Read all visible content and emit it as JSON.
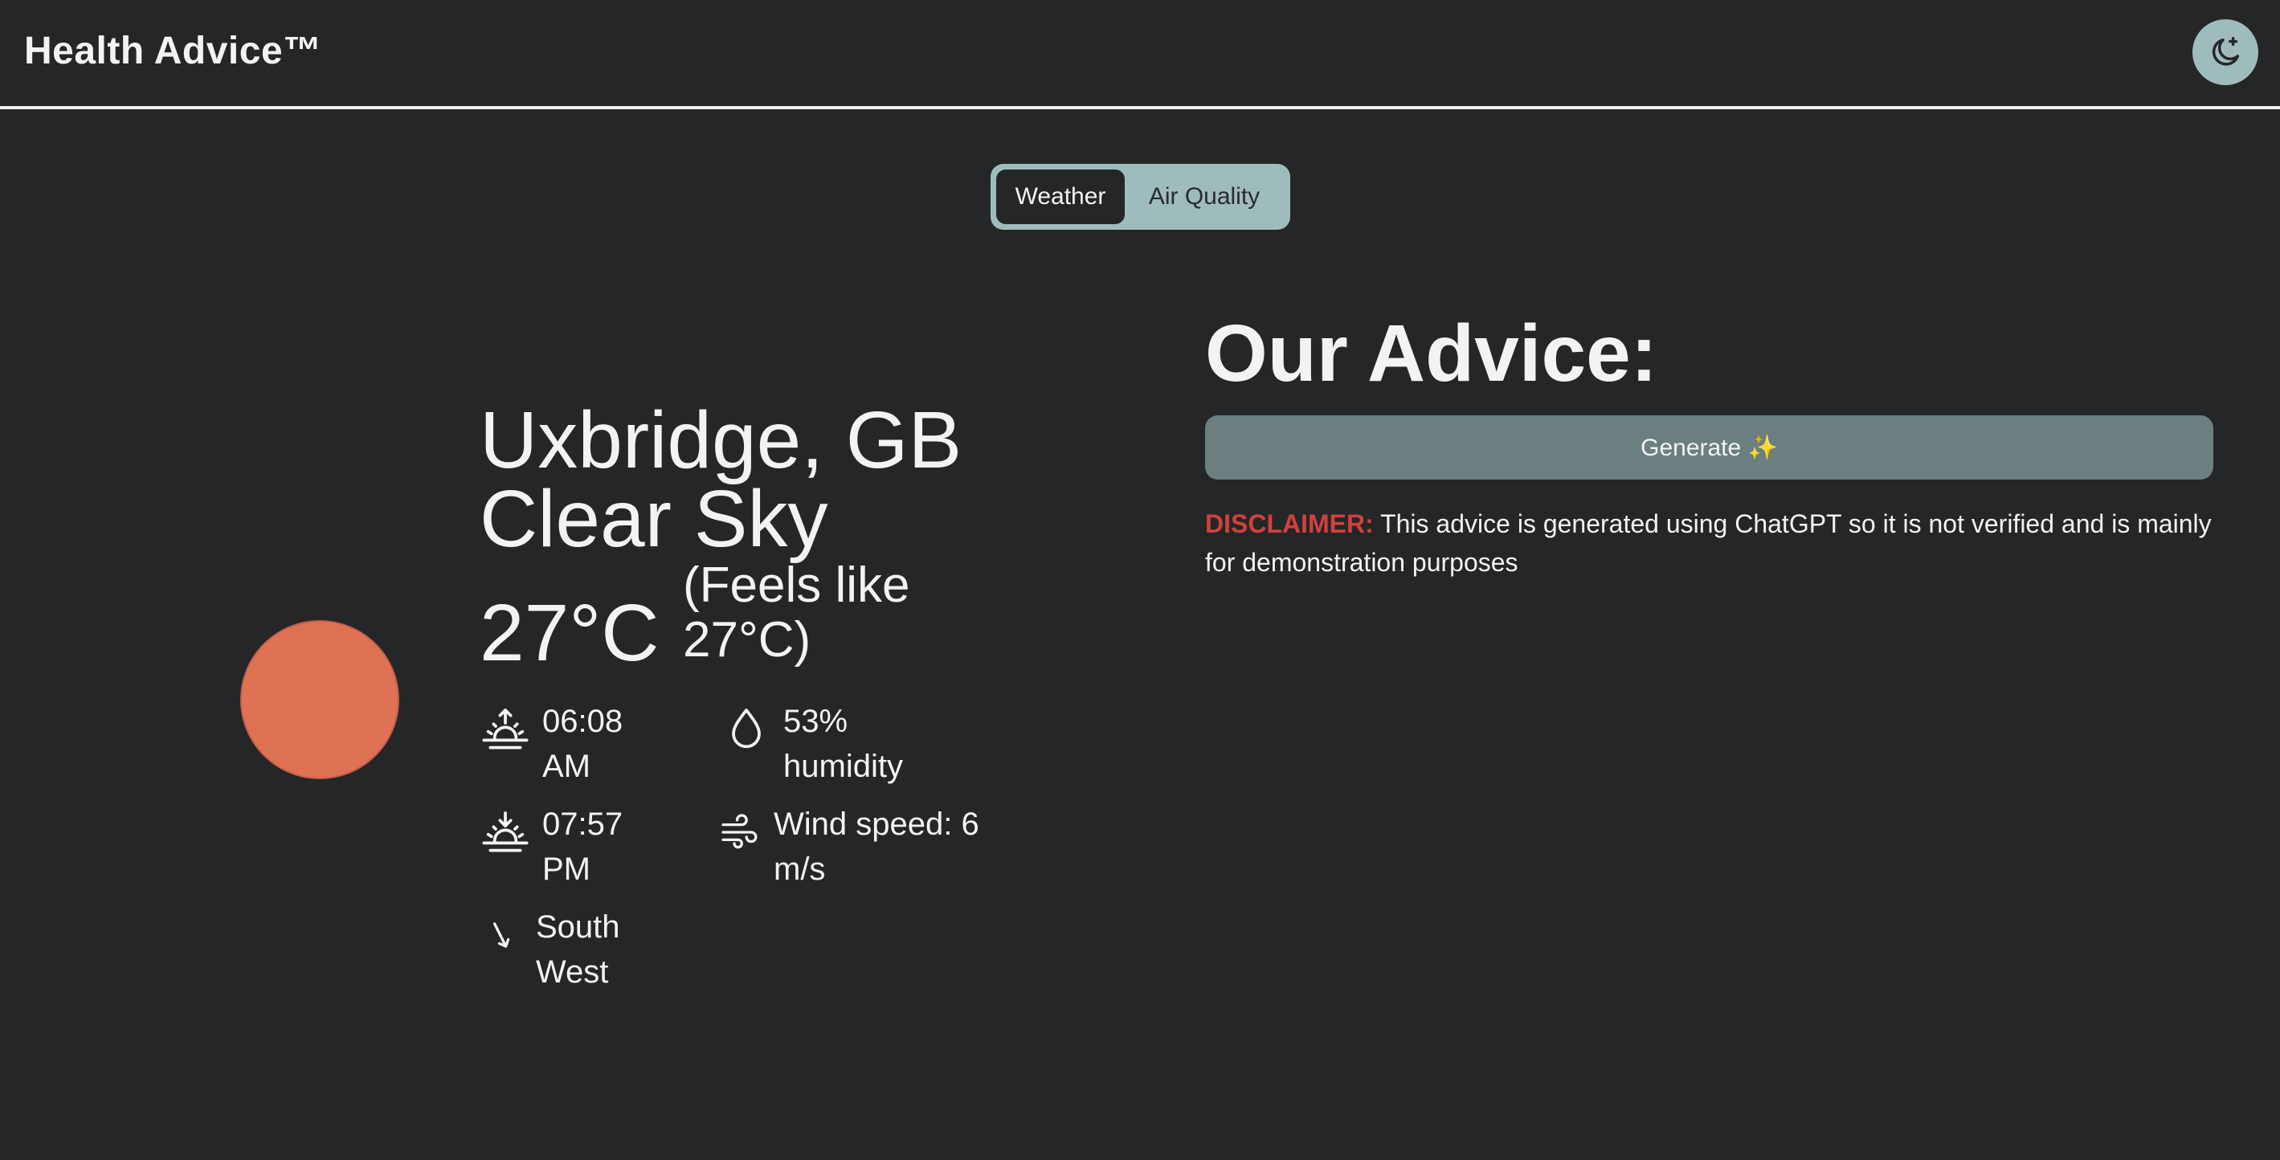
{
  "header": {
    "brand": "Health Advice™",
    "theme_toggle_icon": "moon-icon"
  },
  "tabs": [
    {
      "label": "Weather",
      "active": true
    },
    {
      "label": "Air Quality",
      "active": false
    }
  ],
  "weather": {
    "icon": "sun-icon",
    "location": "Uxbridge, GB",
    "condition": "Clear Sky",
    "temperature": "27°C",
    "feels_like": "(Feels like 27°C)",
    "sunrise": "06:08 AM",
    "sunset": "07:57 PM",
    "humidity": "53% humidity",
    "wind_speed": "Wind speed: 6 m/s",
    "wind_direction": "South West"
  },
  "advice": {
    "title": "Our Advice:",
    "generate_label": "Generate ✨",
    "disclaimer_label": "DISCLAIMER:",
    "disclaimer_text": " This advice is generated using ChatGPT so it is not verified and is mainly for demonstration purposes"
  },
  "colors": {
    "background": "#252628",
    "accent": "#9fbcbd",
    "button": "#6b7f80",
    "sun": "#df7254",
    "warning": "#d1413b"
  }
}
